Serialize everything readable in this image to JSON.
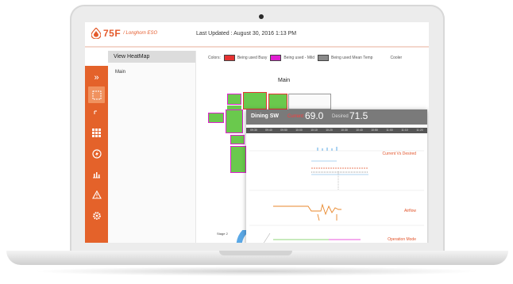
{
  "colors": {
    "brand": "#e4622a",
    "room_green": "#6ac94d",
    "occupied_red": "#e63232",
    "highlight_magenta": "#e01fd1",
    "popup_header": "#7a7a7a"
  },
  "header": {
    "logo_text": "75F",
    "logo_sub": "/ Longhorn ESO",
    "last_updated": "Last Updated : August 30, 2016 1:13 PM"
  },
  "nav": {
    "items": [
      {
        "icon": "chevron-double-right-icon"
      },
      {
        "icon": "floorplan-icon"
      },
      {
        "icon": "bracket-icon"
      },
      {
        "icon": "grid-icon"
      },
      {
        "icon": "power-icon"
      },
      {
        "icon": "bar-chart-icon"
      },
      {
        "icon": "warning-icon"
      },
      {
        "icon": "gear-icon"
      }
    ]
  },
  "tree": {
    "title": "View HeatMap",
    "root": "Main"
  },
  "legend": {
    "prefix": "Colors",
    "items": [
      {
        "label": "Being used Busy",
        "color": "#e63232"
      },
      {
        "label": "Being used - Mild",
        "color": "#e01fd1"
      },
      {
        "label": "Being used Mean Temp",
        "color": "#8a8a8a"
      }
    ],
    "extra": "Cooler"
  },
  "map": {
    "title": "Main"
  },
  "popup": {
    "zone": "Dining SW",
    "current_label": "Current",
    "current_value": "69.0",
    "desired_label": "Desired",
    "desired_value": "71.5",
    "time_ticks": [
      "09:30",
      "09:40",
      "09:50",
      "10:00",
      "10:10",
      "10:20",
      "10:30",
      "10:40",
      "10:50",
      "11:00",
      "11:10",
      "11:20"
    ],
    "charts": [
      "Current Vs Desired",
      "Airflow",
      "Operation Mode"
    ]
  },
  "footer": {
    "stage_left": "Stage 2",
    "stage_mid": "Stage 2"
  }
}
